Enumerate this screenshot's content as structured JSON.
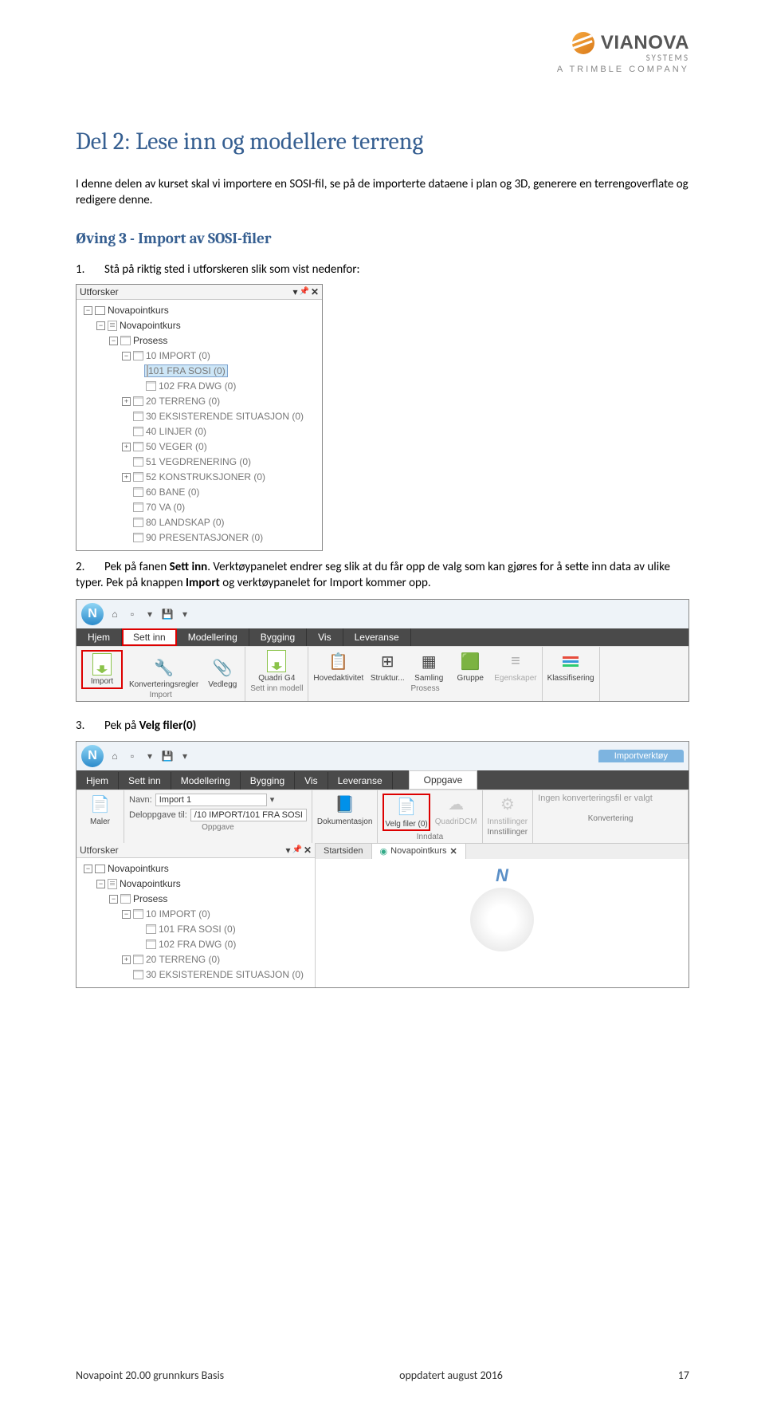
{
  "logo": {
    "brand": "VIANOVA",
    "systems": "SYSTEMS",
    "sub": "A TRIMBLE COMPANY"
  },
  "h1": "Del 2: Lese inn og modellere terreng",
  "intro": "I denne delen av kurset skal vi importere en SOSI-fil, se på de importerte dataene i plan og 3D, generere en terrengoverflate og redigere denne.",
  "h2": "Øving 3 - Import av SOSI-filer",
  "step1": {
    "num": "1.",
    "text": "Stå på riktig sted i utforskeren slik som vist nedenfor:"
  },
  "shot1": {
    "title": "Utforsker",
    "pin": "▾",
    "pin2": "📌",
    "close": "✕",
    "rows": [
      {
        "indent": 0,
        "pm": "−",
        "icon": "box",
        "text": "Novapointkurs"
      },
      {
        "indent": 1,
        "pm": "−",
        "icon": "doc",
        "text": "Novapointkurs"
      },
      {
        "indent": 2,
        "pm": "−",
        "icon": "cal",
        "text": "Prosess"
      },
      {
        "indent": 3,
        "pm": "−",
        "icon": "cal",
        "text": "10 IMPORT (0)",
        "gray": true
      },
      {
        "indent": 4,
        "pm": "",
        "icon": "cal",
        "text": "101 FRA SOSI (0)",
        "gray": true,
        "selected": true
      },
      {
        "indent": 4,
        "pm": "",
        "icon": "cal",
        "text": "102 FRA DWG (0)",
        "gray": true
      },
      {
        "indent": 3,
        "pm": "+",
        "icon": "cal",
        "text": "20 TERRENG (0)",
        "gray": true
      },
      {
        "indent": 3,
        "pm": "",
        "icon": "cal",
        "text": "30 EKSISTERENDE SITUASJON (0)",
        "gray": true
      },
      {
        "indent": 3,
        "pm": "",
        "icon": "cal",
        "text": "40 LINJER (0)",
        "gray": true
      },
      {
        "indent": 3,
        "pm": "+",
        "icon": "cal",
        "text": "50 VEGER (0)",
        "gray": true
      },
      {
        "indent": 3,
        "pm": "",
        "icon": "cal",
        "text": "51 VEGDRENERING (0)",
        "gray": true
      },
      {
        "indent": 3,
        "pm": "+",
        "icon": "cal",
        "text": "52 KONSTRUKSJONER (0)",
        "gray": true
      },
      {
        "indent": 3,
        "pm": "",
        "icon": "cal",
        "text": "60 BANE (0)",
        "gray": true
      },
      {
        "indent": 3,
        "pm": "",
        "icon": "cal",
        "text": "70 VA (0)",
        "gray": true
      },
      {
        "indent": 3,
        "pm": "",
        "icon": "cal",
        "text": "80 LANDSKAP (0)",
        "gray": true
      },
      {
        "indent": 3,
        "pm": "",
        "icon": "cal",
        "text": "90 PRESENTASJONER (0)",
        "gray": true
      }
    ]
  },
  "step2a": {
    "num": "2.",
    "text_pre": "Pek på fanen ",
    "bold1": "Sett inn",
    "text_mid": ". Verktøypanelet endrer seg slik at du får opp de valg som kan gjøres for å sette inn data av ulike typer. Pek på knappen ",
    "bold2": "Import",
    "text_post": " og verktøypanelet for Import kommer opp."
  },
  "shot2": {
    "tabs": [
      "Hjem",
      "Sett inn",
      "Modellering",
      "Bygging",
      "Vis",
      "Leveranse"
    ],
    "active_tab": 1,
    "groups": [
      {
        "label": "Import",
        "buttons": [
          {
            "name": "Import",
            "red": true
          },
          {
            "name": "Konverteringsregler"
          },
          {
            "name": "Vedlegg"
          }
        ]
      },
      {
        "label": "Sett inn modell",
        "buttons": [
          {
            "name": "Quadri G4"
          }
        ]
      },
      {
        "label": "Prosess",
        "buttons": [
          {
            "name": "Hovedaktivitet"
          },
          {
            "name": "Struktur..."
          },
          {
            "name": "Samling"
          },
          {
            "name": "Gruppe"
          },
          {
            "name": "Egenskaper",
            "dis": true
          }
        ]
      },
      {
        "label": "",
        "buttons": [
          {
            "name": "Klassifisering"
          }
        ]
      }
    ]
  },
  "step3": {
    "num": "3.",
    "text_pre": "Pek på ",
    "bold": "Velg filer(0)"
  },
  "shot3": {
    "context": "Importverktøy",
    "tabs": [
      "Hjem",
      "Sett inn",
      "Modellering",
      "Bygging",
      "Vis",
      "Leveranse"
    ],
    "subtab": "Oppgave",
    "navn_lbl": "Navn:",
    "navn_val": "Import 1",
    "delopp_lbl": "Deloppgave til:",
    "delopp_val": "/10 IMPORT/101 FRA SOSI",
    "maler": "Maler",
    "grp_oppgave": "Oppgave",
    "dok": "Dokumentasjon",
    "velg": "Velg filer (0)",
    "quadri": "QuadriDCM",
    "grp_inndata": "Inndata",
    "innst": "Innstillinger",
    "grp_innst": "Innstillinger",
    "konv_msg": "Ingen konverteringsfil er valgt",
    "grp_konv": "Konvertering",
    "utforsker": "Utforsker",
    "startsiden": "Startsiden",
    "novapoint": "Novapointkurs",
    "compass": "N",
    "tree": [
      {
        "indent": 0,
        "pm": "−",
        "icon": "box",
        "text": "Novapointkurs"
      },
      {
        "indent": 1,
        "pm": "−",
        "icon": "doc",
        "text": "Novapointkurs"
      },
      {
        "indent": 2,
        "pm": "−",
        "icon": "cal",
        "text": "Prosess"
      },
      {
        "indent": 3,
        "pm": "−",
        "icon": "cal",
        "text": "10 IMPORT (0)",
        "gray": true
      },
      {
        "indent": 4,
        "pm": "",
        "icon": "cal",
        "text": "101 FRA SOSI (0)",
        "gray": true
      },
      {
        "indent": 4,
        "pm": "",
        "icon": "cal",
        "text": "102 FRA DWG (0)",
        "gray": true
      },
      {
        "indent": 3,
        "pm": "+",
        "icon": "cal",
        "text": "20 TERRENG (0)",
        "gray": true
      },
      {
        "indent": 3,
        "pm": "",
        "icon": "cal",
        "text": "30 EKSISTERENDE SITUASJON (0)",
        "gray": true
      }
    ]
  },
  "footer": {
    "left": "Novapoint 20.00 grunnkurs Basis",
    "center": "oppdatert august 2016",
    "right": "17"
  }
}
